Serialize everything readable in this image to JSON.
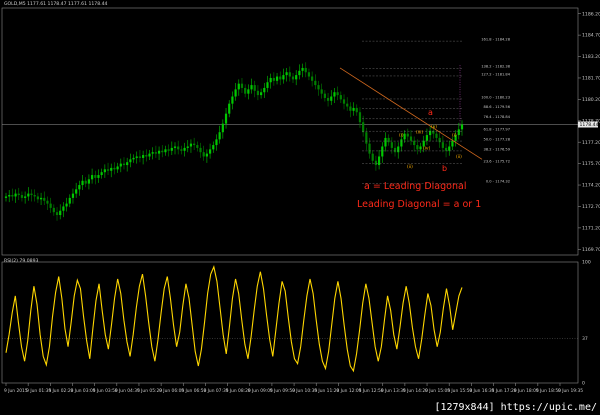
{
  "header": {
    "symbol_line": "GOLD,M5  1177.61 1178.47 1177.61 1178.44"
  },
  "rsi_header": "RSI(2) 79.0893",
  "annotations": {
    "line1": "a = Leading Diagonal",
    "line2": "Leading Diagonal = a or 1",
    "wave_a": "a",
    "wave_b": "b",
    "wave_labels": [
      "(i)",
      "(ii)",
      "(iii)",
      "(iv)",
      "(v)",
      "(i)",
      "(ii)"
    ]
  },
  "fib_levels": [
    {
      "label": "161.8 - 1184.28",
      "price": 1184.28
    },
    {
      "label": "138.2 - 1182.38",
      "price": 1182.38
    },
    {
      "label": "127.2 - 1181.84",
      "price": 1181.84
    },
    {
      "label": "100.0 - 1180.23",
      "price": 1180.23
    },
    {
      "label": "88.6 - 1179.56",
      "price": 1179.56
    },
    {
      "label": "76.4 - 1178.84",
      "price": 1178.84
    },
    {
      "label": "61.8 - 1177.97",
      "price": 1177.97
    },
    {
      "label": "50.0 - 1177.28",
      "price": 1177.28
    },
    {
      "label": "38.2 - 1176.59",
      "price": 1176.59
    },
    {
      "label": "23.6 - 1175.72",
      "price": 1175.72
    },
    {
      "label": "0.0 - 1174.32",
      "price": 1174.32
    }
  ],
  "watermark": "[1279x844] https://upic.me/",
  "colors": {
    "bull": "#00c800",
    "bear": "#008000",
    "rsi": "#ffd700",
    "trend": "#d2691e",
    "annotation": "#ff2a1a",
    "fib": "#6f6f6f"
  },
  "chart_data": [
    {
      "type": "candlestick",
      "title": "GOLD,M5",
      "y_ticks": [
        1186.2,
        1184.7,
        1183.2,
        1181.7,
        1180.2,
        1178.7,
        1177.2,
        1175.7,
        1174.2,
        1172.7,
        1171.2,
        1169.7
      ],
      "ylim": [
        1169.3,
        1186.6
      ],
      "current_price": 1178.44,
      "x_ticks": [
        "9 Jun 2015",
        "9 Jun 01:35",
        "9 Jun 02:20",
        "9 Jun 03:05",
        "9 Jun 03:50",
        "9 Jun 04:35",
        "9 Jun 05:20",
        "9 Jun 06:05",
        "9 Jun 06:50",
        "9 Jun 07:35",
        "9 Jun 08:20",
        "9 Jun 09:05",
        "9 Jun 09:50",
        "9 Jun 10:35",
        "9 Jun 11:20",
        "9 Jun 12:05",
        "9 Jun 12:50",
        "9 Jun 13:35",
        "9 Jun 14:20",
        "9 Jun 15:05",
        "9 Jun 15:50",
        "9 Jun 16:35",
        "9 Jun 17:20",
        "9 Jun 18:05",
        "9 Jun 18:50",
        "9 Jun 19:35"
      ],
      "close": [
        1173.4,
        1173.5,
        1173.4,
        1173.6,
        1173.5,
        1173.3,
        1173.4,
        1173.6,
        1173.5,
        1173.4,
        1173.2,
        1173.3,
        1173.1,
        1172.9,
        1172.6,
        1172.3,
        1172.1,
        1172.4,
        1172.7,
        1172.9,
        1173.3,
        1173.6,
        1173.9,
        1174.2,
        1174.5,
        1174.3,
        1174.6,
        1174.9,
        1174.7,
        1174.9,
        1175.1,
        1175.3,
        1175.2,
        1175.4,
        1175.3,
        1175.5,
        1175.7,
        1175.6,
        1175.8,
        1176.0,
        1176.1,
        1176.2,
        1176.1,
        1176.3,
        1176.2,
        1176.4,
        1176.5,
        1176.4,
        1176.6,
        1176.5,
        1176.7,
        1176.6,
        1176.8,
        1176.9,
        1176.7,
        1176.6,
        1176.8,
        1176.9,
        1177.1,
        1177.0,
        1176.8,
        1176.5,
        1176.2,
        1176.4,
        1176.7,
        1177.0,
        1177.4,
        1177.9,
        1178.5,
        1179.2,
        1179.9,
        1180.4,
        1180.9,
        1181.3,
        1181.0,
        1180.6,
        1180.9,
        1181.2,
        1180.8,
        1180.5,
        1180.7,
        1181.0,
        1181.4,
        1181.7,
        1181.5,
        1181.8,
        1181.6,
        1181.9,
        1182.1,
        1181.8,
        1181.6,
        1181.9,
        1182.2,
        1182.4,
        1182.1,
        1181.8,
        1181.5,
        1181.2,
        1180.9,
        1180.6,
        1180.3,
        1180.1,
        1180.4,
        1180.7,
        1180.5,
        1180.2,
        1179.9,
        1179.7,
        1179.4,
        1179.6,
        1179.3,
        1178.6,
        1177.9,
        1177.1,
        1176.4,
        1175.9,
        1175.6,
        1176.2,
        1176.9,
        1177.5,
        1177.2,
        1176.8,
        1176.5,
        1176.9,
        1177.4,
        1177.8,
        1177.6,
        1177.3,
        1177.0,
        1176.7,
        1176.9,
        1177.3,
        1177.7,
        1178.0,
        1177.8,
        1177.5,
        1177.2,
        1176.8,
        1176.6,
        1176.9,
        1177.3,
        1177.7,
        1178.1,
        1178.44
      ]
    },
    {
      "type": "line",
      "title": "RSI(2) 79.0893",
      "y_ticks": [
        100,
        37,
        0
      ],
      "ylim": [
        0,
        100
      ],
      "values": [
        25,
        40,
        58,
        72,
        50,
        30,
        18,
        35,
        60,
        80,
        65,
        40,
        22,
        15,
        30,
        55,
        75,
        88,
        70,
        45,
        30,
        50,
        72,
        85,
        78,
        55,
        35,
        20,
        45,
        68,
        82,
        60,
        40,
        28,
        48,
        70,
        86,
        74,
        52,
        34,
        22,
        40,
        62,
        80,
        90,
        72,
        50,
        30,
        18,
        36,
        58,
        78,
        88,
        70,
        48,
        30,
        42,
        64,
        82,
        70,
        48,
        26,
        14,
        28,
        50,
        74,
        90,
        96,
        84,
        62,
        40,
        24,
        46,
        70,
        86,
        74,
        52,
        32,
        20,
        38,
        60,
        80,
        92,
        78,
        56,
        36,
        22,
        44,
        66,
        84,
        76,
        54,
        34,
        20,
        16,
        30,
        52,
        72,
        86,
        74,
        52,
        32,
        18,
        12,
        26,
        48,
        70,
        84,
        70,
        48,
        28,
        14,
        10,
        24,
        44,
        66,
        82,
        70,
        50,
        30,
        18,
        30,
        52,
        72,
        60,
        40,
        28,
        46,
        66,
        80,
        66,
        46,
        30,
        20,
        36,
        56,
        74,
        64,
        44,
        30,
        42,
        62,
        78,
        64,
        44,
        58,
        72,
        79
      ]
    }
  ]
}
